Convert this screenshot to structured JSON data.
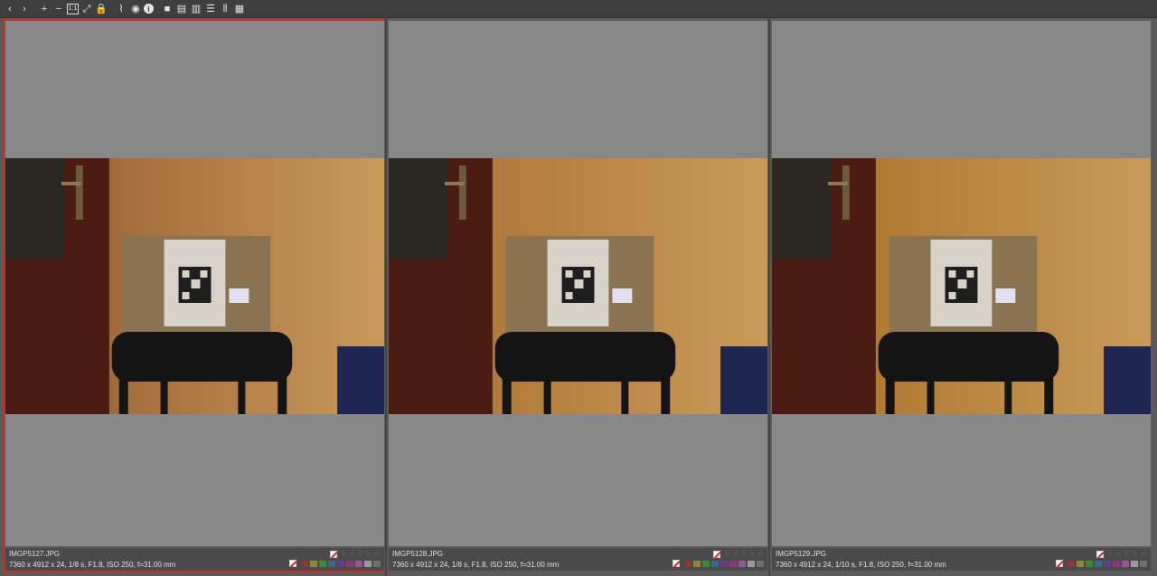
{
  "toolbar": {
    "buttons": [
      {
        "name": "back-icon",
        "glyph": "‹"
      },
      {
        "name": "forward-icon",
        "glyph": "›"
      },
      {
        "name": "zoom-in-icon",
        "glyph": "+"
      },
      {
        "name": "zoom-out-icon",
        "glyph": "−"
      },
      {
        "name": "zoom-100-icon",
        "glyph": "1:1"
      },
      {
        "name": "zoom-fit-icon",
        "glyph": "⤢"
      },
      {
        "name": "lock-icon",
        "glyph": "🔒"
      },
      {
        "name": "histogram-icon",
        "glyph": "⌇"
      },
      {
        "name": "focus-peaking-icon",
        "glyph": "◉"
      },
      {
        "name": "info-icon",
        "glyph": "i"
      },
      {
        "name": "layout-single-icon",
        "glyph": "■"
      },
      {
        "name": "layout-2-horizontal-icon",
        "glyph": "▤"
      },
      {
        "name": "layout-2-vertical-icon",
        "glyph": "▥"
      },
      {
        "name": "layout-3-horizontal-icon",
        "glyph": "☰"
      },
      {
        "name": "layout-3-vertical-icon",
        "glyph": "⫴"
      },
      {
        "name": "layout-grid-icon",
        "glyph": "▦"
      }
    ]
  },
  "panes": [
    {
      "filename": "IMGP5127.JPG",
      "exif": "7360 x 4912 x 24, 1/8 s, F1.8, ISO 250, f=31.00 mm",
      "selected": true,
      "tint": "#a26a3a"
    },
    {
      "filename": "IMGP5128.JPG",
      "exif": "7360 x 4912 x 24, 1/8 s, F1.8, ISO 250, f=31.00 mm",
      "selected": false,
      "tint": "#b07a3a"
    },
    {
      "filename": "IMGP5129.JPG",
      "exif": "7360 x 4912 x 24, 1/10 s, F1.8, ISO 250, f=31.00 mm",
      "selected": false,
      "tint": "#b07a34"
    }
  ],
  "colors": {
    "selection": "#d02a2a",
    "label_swatches": [
      "#8a3a3a",
      "#8a8a3a",
      "#3a8a3a",
      "#3a6a8a",
      "#6a3a8a",
      "#8a3a7a",
      "#8a5a8a",
      "#9a9a9a",
      "#707070"
    ]
  }
}
